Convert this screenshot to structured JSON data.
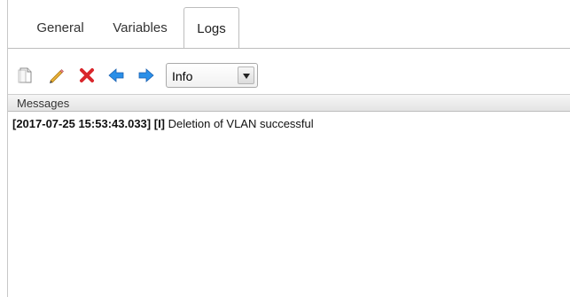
{
  "tabs": [
    {
      "label": "General",
      "active": false
    },
    {
      "label": "Variables",
      "active": false
    },
    {
      "label": "Logs",
      "active": true
    }
  ],
  "toolbar": {
    "buttons": [
      {
        "icon": "new-document-icon"
      },
      {
        "icon": "pencil-edit-icon"
      },
      {
        "icon": "red-x-delete-icon"
      },
      {
        "icon": "arrow-left-icon"
      },
      {
        "icon": "arrow-right-icon"
      }
    ],
    "level_select": {
      "value": "Info"
    }
  },
  "messages": {
    "header": "Messages",
    "entries": [
      {
        "timestamp": "[2017-07-25 15:53:43.033]",
        "level": "[I]",
        "text": "Deletion of VLAN successful"
      }
    ]
  },
  "colors": {
    "accent_arrow": "#1e90ff",
    "delete_red": "#d9262b",
    "pencil": "#e8b13a"
  }
}
